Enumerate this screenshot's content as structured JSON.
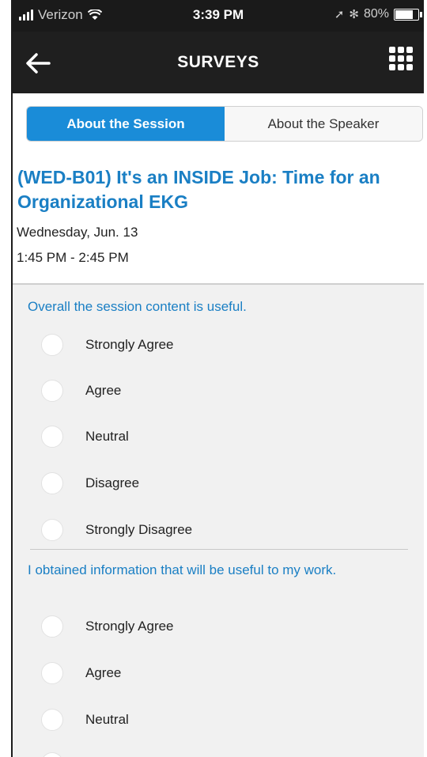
{
  "status_bar": {
    "carrier": "Verizon",
    "time": "3:39 PM",
    "battery_text": "80%",
    "battery_level": 0.8
  },
  "nav": {
    "title": "SURVEYS",
    "back_icon": "arrow-left-icon",
    "menu_icon": "grid-menu-icon"
  },
  "tabs": [
    {
      "label": "About the Session",
      "active": true
    },
    {
      "label": "About the Speaker",
      "active": false
    }
  ],
  "session": {
    "title": "(WED-B01) It's an INSIDE Job: Time for an Organizational EKG",
    "date": "Wednesday, Jun. 13",
    "time": "1:45 PM - 2:45 PM"
  },
  "questions": [
    {
      "text": "Overall the session content is useful.",
      "options": [
        "Strongly Agree",
        "Agree",
        "Neutral",
        "Disagree",
        "Strongly Disagree"
      ]
    },
    {
      "text": "I obtained information that will be useful to my work.",
      "options": [
        "Strongly Agree",
        "Agree",
        "Neutral"
      ]
    }
  ],
  "colors": {
    "accent": "#1a8cd8",
    "heading_blue": "#1a7fc4",
    "nav_background": "#1f1f1f"
  }
}
